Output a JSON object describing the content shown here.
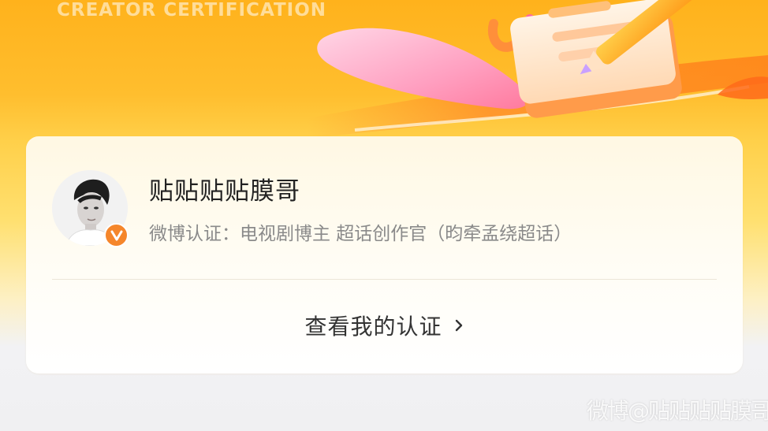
{
  "banner": {
    "subtitle": "CREATOR CERTIFICATION"
  },
  "profile": {
    "username": "贴贴贴贴膜哥",
    "certification": "微博认证：电视剧博主  超话创作官（昀牵孟绕超话）",
    "badge_icon": "verified-v-icon",
    "avatar": "user-avatar"
  },
  "actions": {
    "view_certification": "查看我的认证",
    "chevron_icon": "chevron-right-icon"
  },
  "watermark": {
    "text": "微博@贴贴贴贴膜哥"
  },
  "colors": {
    "accent": "#f5862b",
    "banner_orange": "#ffb21c",
    "text_primary": "#222222",
    "text_secondary": "#8a8a8a"
  }
}
